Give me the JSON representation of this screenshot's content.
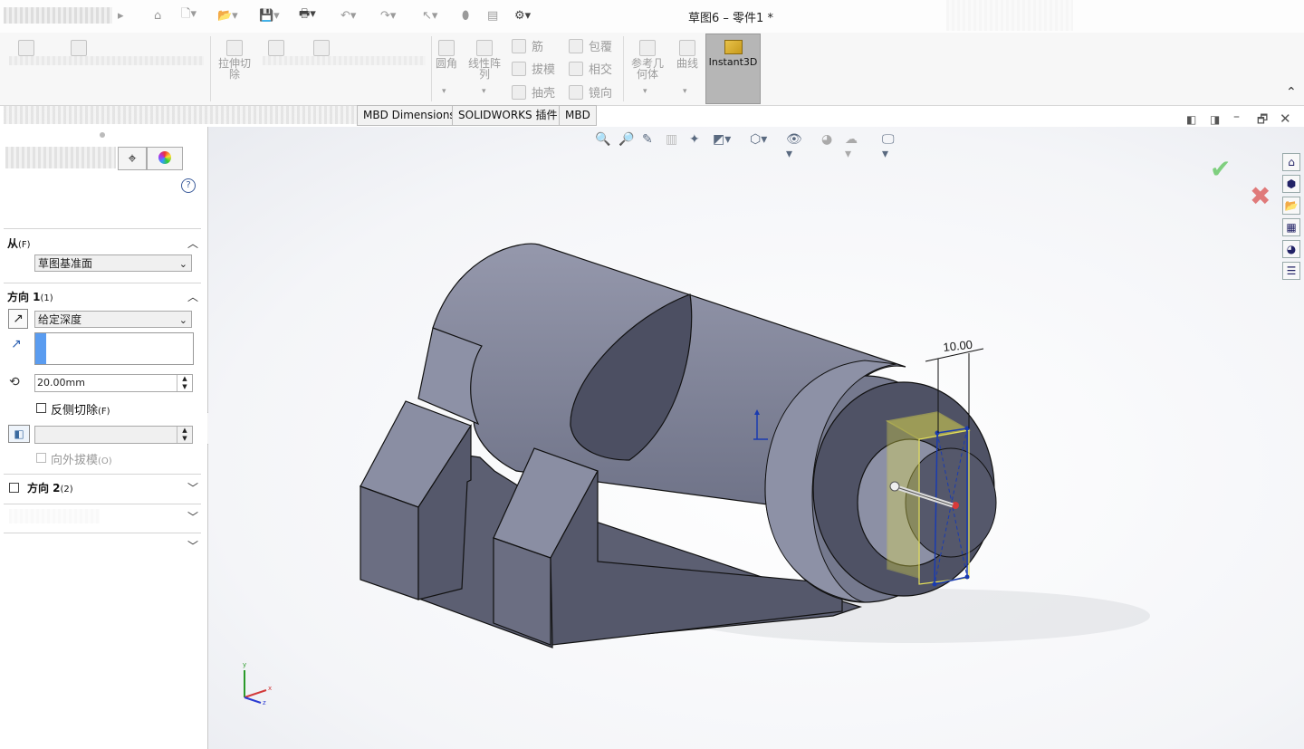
{
  "window": {
    "title": "草图6 – 零件1 *"
  },
  "ribbon": {
    "extrude_cut_label": "拉伸切\n除",
    "fillet_label": "圆角",
    "linear_pattern_label": "线性阵\n列",
    "rib_label": "筋",
    "draft_label": "拔模",
    "shell_label": "抽壳",
    "wrap_label": "包覆",
    "intersect_label": "相交",
    "mirror_label": "镜向",
    "ref_geometry_label": "参考几\n何体",
    "curves_label": "曲线",
    "instant3d_label": "Instant3D"
  },
  "tabs": [
    {
      "label": "MBD Dimensions"
    },
    {
      "label": "SOLIDWORKS 插件"
    },
    {
      "label": "MBD"
    }
  ],
  "panel": {
    "help": "?",
    "from": {
      "title": "从",
      "key": "(F)",
      "value": "草图基准面"
    },
    "direction1": {
      "title": "方向 1",
      "key": "(1)",
      "end_condition": "给定深度",
      "depth": "20.00mm",
      "flip_label": "反侧切除",
      "flip_key": "(F)",
      "draft_outward_label": "向外拔模",
      "draft_outward_key": "(O)"
    },
    "direction2": {
      "title": "方向 2",
      "key": "(2)"
    }
  },
  "viewport": {
    "dimension": "10.00",
    "triad": {
      "x": "x",
      "y": "y",
      "z": "z"
    }
  },
  "colors": {
    "model_face": "#8b8fa6",
    "model_dark": "#5c5f72",
    "sketch_yellow": "#e8e44a",
    "accept_green": "#7fcf7f",
    "cancel_red": "#e07a7a"
  }
}
